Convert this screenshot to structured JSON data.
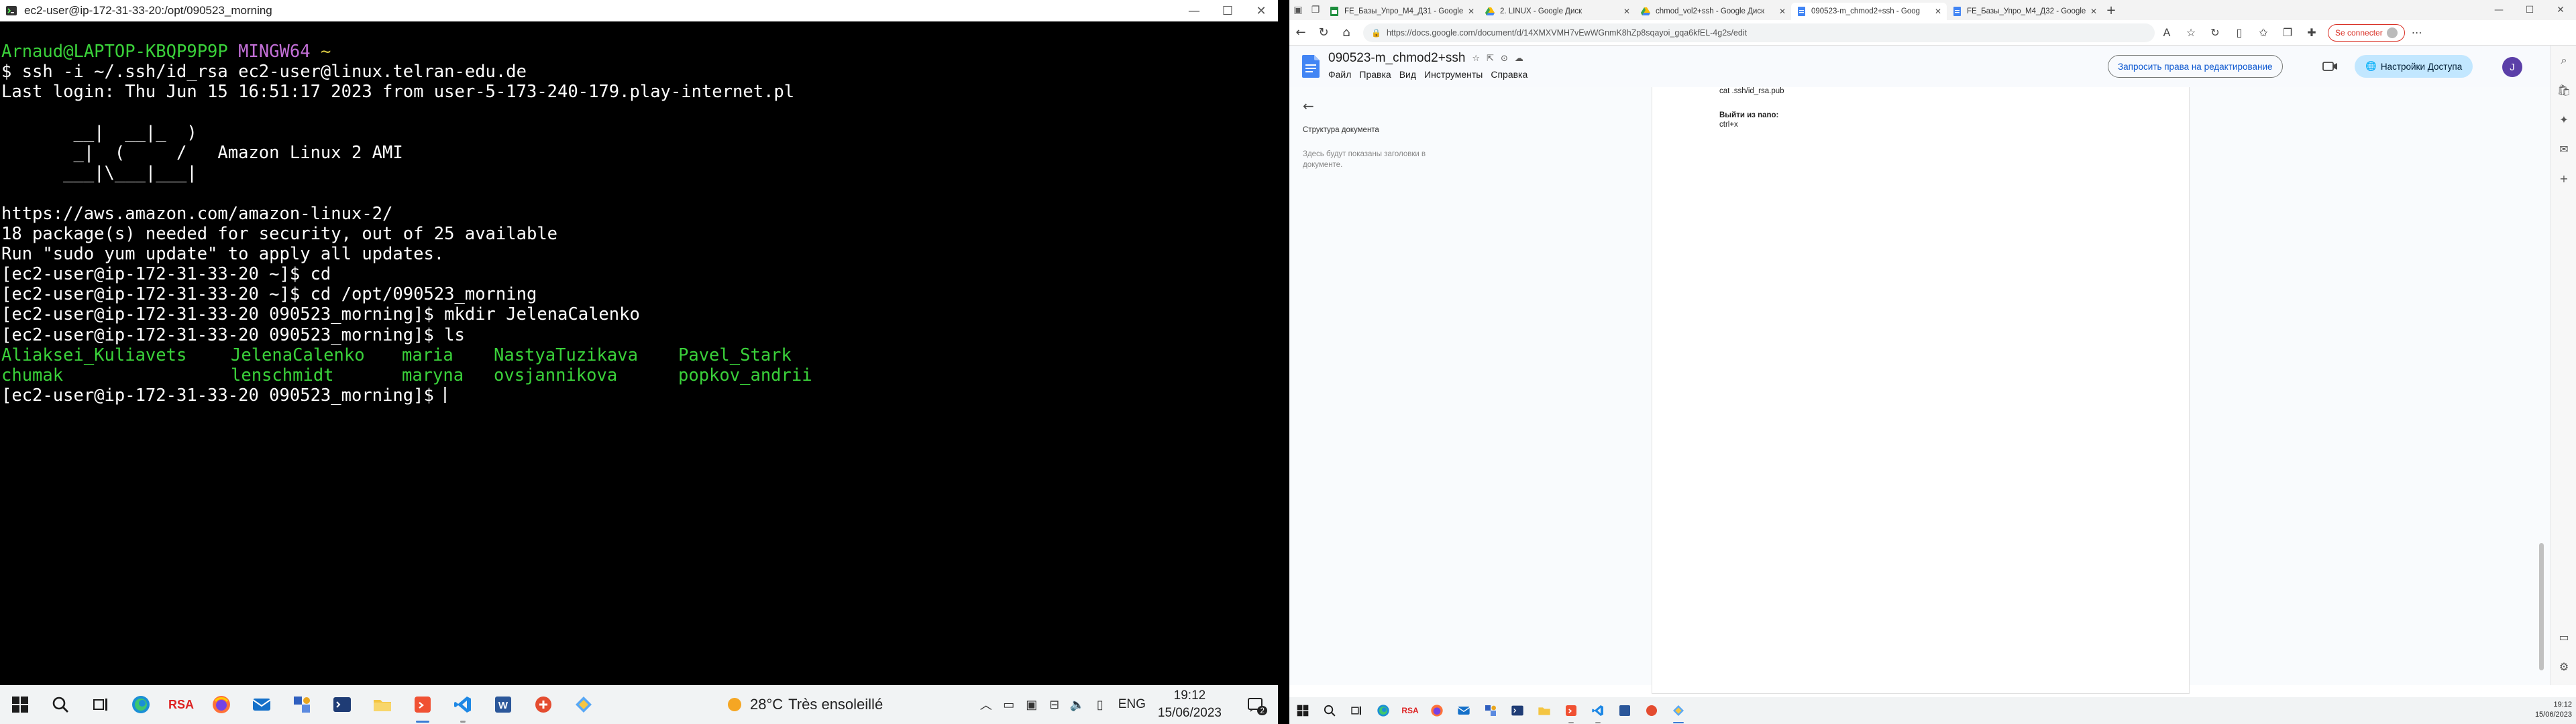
{
  "terminal": {
    "title": "ec2-user@ip-172-31-33-20:/opt/090523_morning",
    "prompt_user": "Arnaud@LAPTOP-KBQP9P9P",
    "prompt_app": "MINGW64",
    "prompt_path": "~",
    "cmd_ssh": "$ ssh -i ~/.ssh/id_rsa ec2-user@linux.telran-edu.de",
    "last_login": "Last login: Thu Jun 15 16:51:17 2023 from user-5-173-240-179.play-internet.pl",
    "ascii": [
      "       __|  __|_  )",
      "       _|  (     /   Amazon Linux 2 AMI",
      "      ___|\\___|___|"
    ],
    "info": [
      "https://aws.amazon.com/amazon-linux-2/",
      "18 package(s) needed for security, out of 25 available",
      "Run \"sudo yum update\" to apply all updates."
    ],
    "history": [
      "[ec2-user@ip-172-31-33-20 ~]$ cd",
      "[ec2-user@ip-172-31-33-20 ~]$ cd /opt/090523_morning",
      "[ec2-user@ip-172-31-33-20 090523_morning]$ mkdir JelenaCalenko",
      "[ec2-user@ip-172-31-33-20 090523_morning]$ ls"
    ],
    "ls_output": [
      "Aliaksei_Kuliavets",
      "JelenaCalenko",
      "maria",
      "NastyaTuzikava",
      "Pavel_Stark",
      "chumak",
      "lenschmidt",
      "maryna",
      "ovsjannikova",
      "popkov_andrii"
    ],
    "current_prompt": "[ec2-user@ip-172-31-33-20 090523_morning]$ "
  },
  "taskbar_left": {
    "rsa_label": "RSA",
    "weather_temp": "28°C",
    "weather_text": "Très ensoleillé",
    "lang": "ENG",
    "time": "19:12",
    "date": "15/06/2023",
    "notif_count": "2"
  },
  "browser": {
    "tabs": [
      {
        "label": "FE_Базы_Упро_M4_Д31 - Google"
      },
      {
        "label": "2. LINUX - Google Диск"
      },
      {
        "label": "chmod_vol2+ssh - Google Диск"
      },
      {
        "label": "090523-m_chmod2+ssh - Goog"
      },
      {
        "label": "FE_Базы_Упро_M4_Д32 - Google"
      }
    ],
    "active_tab": 3,
    "url": "https://docs.google.com/document/d/14XMXVMH7vEwWGnmK8hZp8sqayoi_gqa6kfEL-4g2s/edit",
    "sync_label": "Se connecter"
  },
  "docs": {
    "title": "090523-m_chmod2+ssh",
    "menu": [
      "Файл",
      "Правка",
      "Вид",
      "Инструменты",
      "Справка"
    ],
    "request_edit": "Запросить права на редактирование",
    "share": "Настройки Доступа",
    "user_initial": "J",
    "outline_title": "Структура документа",
    "outline_hint": "Здесь будут показаны заголовки в документе.",
    "content_code": "cat .ssh/id_rsa.pub",
    "content_heading": "Выйти из nano:",
    "content_line": "ctrl+x"
  },
  "taskbar_right": {
    "rsa_label": "RSA",
    "time": "19:12",
    "date": "15/06/2023"
  },
  "colors": {
    "terminal_green": "#3ad13a",
    "terminal_purple": "#c26fd6",
    "terminal_yellow": "#d7c641",
    "share_bg": "#c2e7ff",
    "sync_red": "#d93025"
  }
}
